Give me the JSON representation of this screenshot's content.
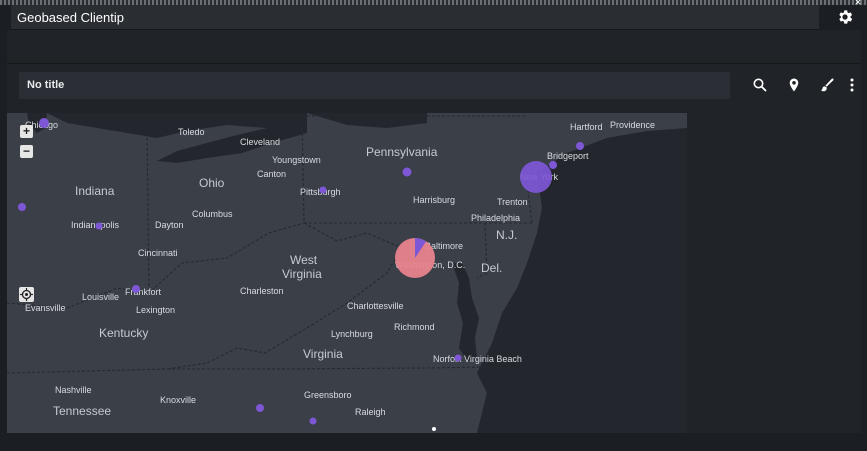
{
  "dashboard": {
    "panel_title": "Geobased Clientip"
  },
  "icons": {
    "close": "close-icon",
    "settings": "gear-icon",
    "search": "search-icon",
    "location": "map-pin-icon",
    "brush": "paintbrush-icon",
    "more": "kebab-menu-icon",
    "zoom_in": "plus-icon",
    "zoom_out": "minus-icon",
    "locate": "crosshair-icon"
  },
  "visualization": {
    "title": "No title",
    "zoom_in_label": "+",
    "zoom_out_label": "−"
  },
  "map": {
    "labels": {
      "chicago": "Chicago",
      "toledo": "Toledo",
      "cleveland": "Cleveland",
      "youngstown": "Youngstown",
      "canton": "Canton",
      "pennsylvania": "Pennsylvania",
      "hartford": "Hartford",
      "providence": "Providence",
      "bridgeport": "Bridgeport",
      "new_york": "New York",
      "indiana": "Indiana",
      "ohio": "Ohio",
      "pittsburgh": "Pittsburgh",
      "harrisburg": "Harrisburg",
      "trenton": "Trenton",
      "philadelphia": "Philadelphia",
      "nj": "N.J.",
      "indianapolis": "Indianapolis",
      "dayton": "Dayton",
      "columbus": "Columbus",
      "cincinnati": "Cincinnati",
      "west_virginia_1": "West",
      "west_virginia_2": "Virginia",
      "baltimore": "Baltimore",
      "washington": "Washington, D.C.",
      "del": "Del.",
      "louisville": "Louisville",
      "frankfort": "Frankfort",
      "charleston": "Charleston",
      "evansville": "Evansville",
      "lexington": "Lexington",
      "charlottesville": "Charlottesville",
      "kentucky": "Kentucky",
      "richmond": "Richmond",
      "lynchburg": "Lynchburg",
      "virginia": "Virginia",
      "norfolk_vb": "Norfolk Virginia Beach",
      "nashville": "Nashville",
      "knoxville": "Knoxville",
      "greensboro": "Greensboro",
      "raleigh": "Raleigh",
      "tennessee": "Tennessee"
    },
    "colors": {
      "land": "#3a3f48",
      "sea": "#23272d",
      "marker": "#7e57d6",
      "pie_major": "#e8838d"
    }
  }
}
